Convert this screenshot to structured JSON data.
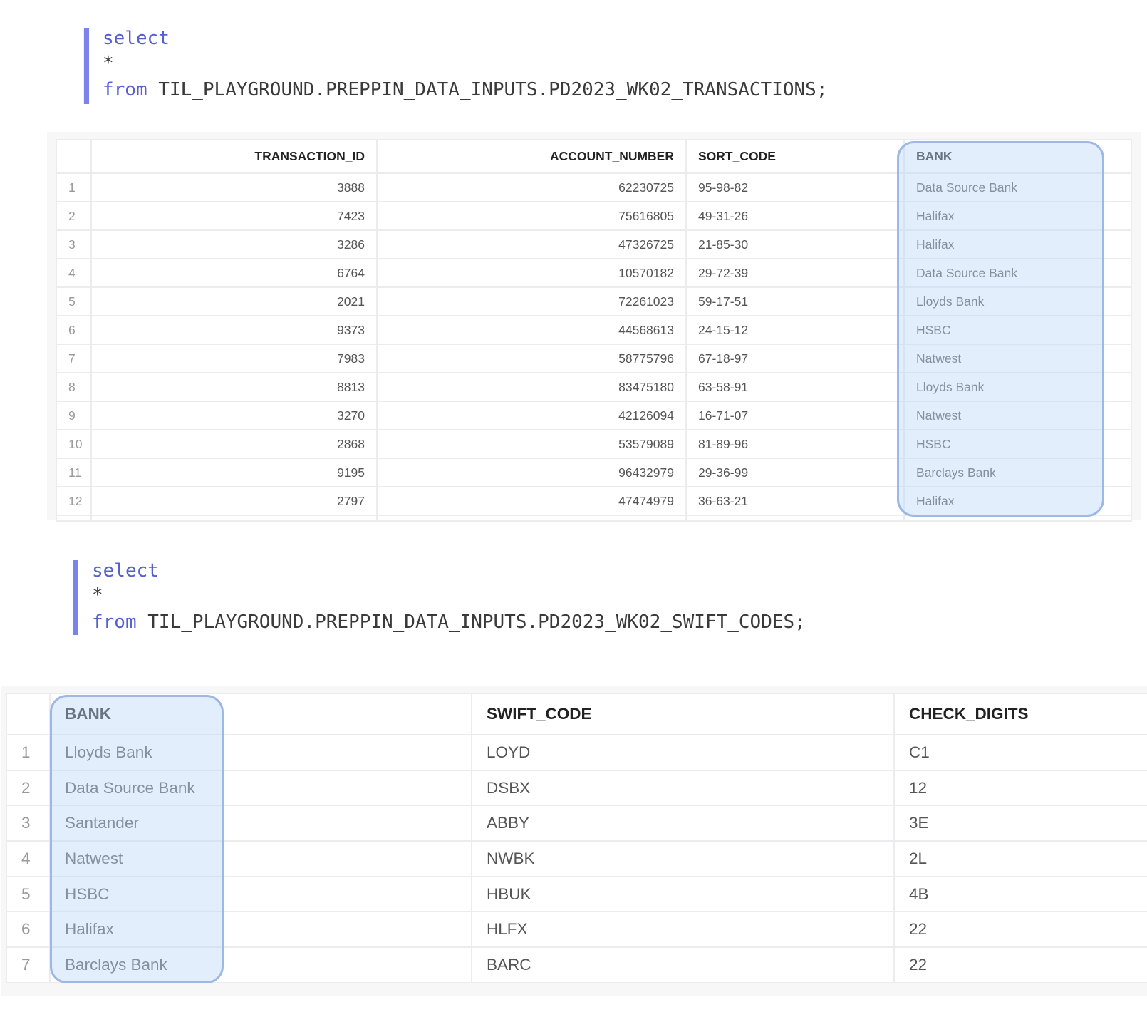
{
  "query1": {
    "keyword_select": "select",
    "star": "*",
    "keyword_from": "from",
    "table": " TIL_PLAYGROUND.PREPPIN_DATA_INPUTS.PD2023_WK02_TRANSACTIONS;"
  },
  "table1": {
    "columns": [
      "TRANSACTION_ID",
      "ACCOUNT_NUMBER",
      "SORT_CODE",
      "BANK"
    ],
    "rows": [
      [
        "1",
        "3888",
        "62230725",
        "95-98-82",
        "Data Source Bank"
      ],
      [
        "2",
        "7423",
        "75616805",
        "49-31-26",
        "Halifax"
      ],
      [
        "3",
        "3286",
        "47326725",
        "21-85-30",
        "Halifax"
      ],
      [
        "4",
        "6764",
        "10570182",
        "29-72-39",
        "Data Source Bank"
      ],
      [
        "5",
        "2021",
        "72261023",
        "59-17-51",
        "Lloyds Bank"
      ],
      [
        "6",
        "9373",
        "44568613",
        "24-15-12",
        "HSBC"
      ],
      [
        "7",
        "7983",
        "58775796",
        "67-18-97",
        "Natwest"
      ],
      [
        "8",
        "8813",
        "83475180",
        "63-58-91",
        "Lloyds Bank"
      ],
      [
        "9",
        "3270",
        "42126094",
        "16-71-07",
        "Natwest"
      ],
      [
        "10",
        "2868",
        "53579089",
        "81-89-96",
        "HSBC"
      ],
      [
        "11",
        "9195",
        "96432979",
        "29-36-99",
        "Barclays Bank"
      ],
      [
        "12",
        "2797",
        "47474979",
        "36-63-21",
        "Halifax"
      ]
    ]
  },
  "query2": {
    "keyword_select": "select",
    "star": "*",
    "keyword_from": "from",
    "table": " TIL_PLAYGROUND.PREPPIN_DATA_INPUTS.PD2023_WK02_SWIFT_CODES;"
  },
  "table2": {
    "columns": [
      "BANK",
      "SWIFT_CODE",
      "CHECK_DIGITS"
    ],
    "rows": [
      [
        "1",
        "Lloyds Bank",
        "LOYD",
        "C1"
      ],
      [
        "2",
        "Data Source Bank",
        "DSBX",
        "12"
      ],
      [
        "3",
        "Santander",
        "ABBY",
        "3E"
      ],
      [
        "4",
        "Natwest",
        "NWBK",
        "2L"
      ],
      [
        "5",
        "HSBC",
        "HBUK",
        "4B"
      ],
      [
        "6",
        "Halifax",
        "HLFX",
        "22"
      ],
      [
        "7",
        "Barclays Bank",
        "BARC",
        "22"
      ]
    ]
  }
}
